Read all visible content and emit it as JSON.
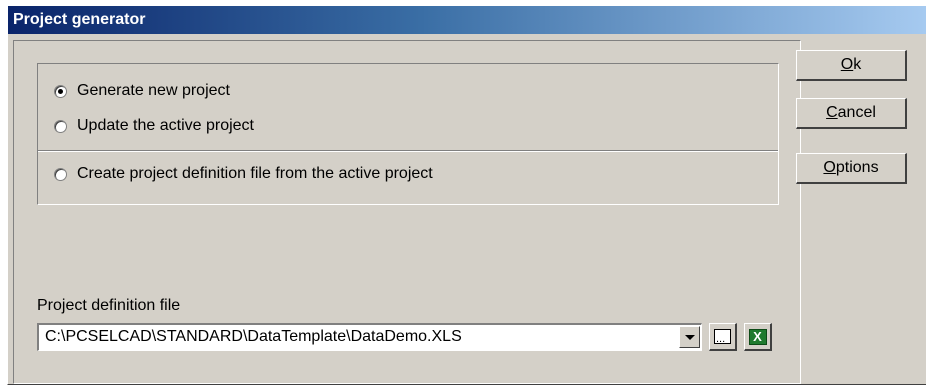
{
  "window": {
    "title": "Project generator"
  },
  "options": {
    "generate_new": {
      "label": "Generate new project",
      "checked": true
    },
    "update_active": {
      "label": "Update the active project",
      "checked": false
    },
    "create_definition": {
      "label": "Create project definition file from the active project",
      "checked": false
    }
  },
  "definition_file": {
    "label": "Project definition file",
    "value": "C:\\PCSELCAD\\STANDARD\\DataTemplate\\DataDemo.XLS"
  },
  "buttons": {
    "ok": {
      "mnemonic": "O",
      "rest": "k"
    },
    "cancel": {
      "mnemonic": "C",
      "rest": "ancel"
    },
    "options": {
      "mnemonic": "O",
      "rest": "ptions"
    }
  },
  "icons": {
    "browse": "browse-icon",
    "excel": "excel-icon",
    "excel_letter": "X"
  },
  "colors": {
    "titlebar_start": "#0a246a",
    "dialog_face": "#d4d0c8",
    "excel_green": "#1f7a2e"
  }
}
